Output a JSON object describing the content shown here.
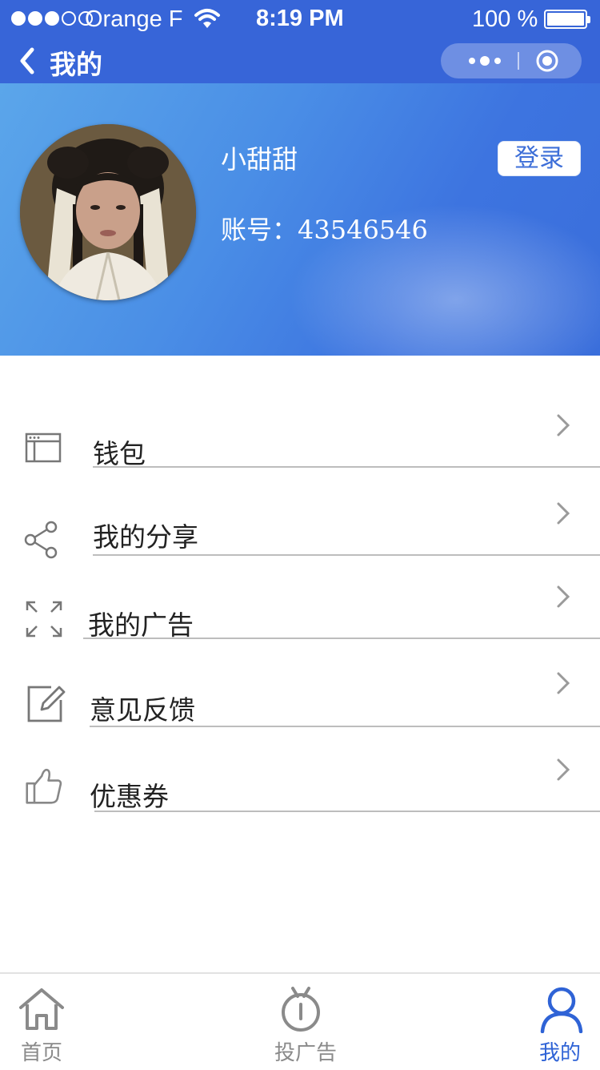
{
  "status_bar": {
    "carrier": "Orange F",
    "time": "8:19 PM",
    "battery": "100 %",
    "signal_bars_filled": 3,
    "signal_bars_total": 5
  },
  "nav": {
    "title": "我的"
  },
  "profile": {
    "username": "小甜甜",
    "account_label": "账号：",
    "account_number": "43546546",
    "login_label": "登录"
  },
  "menu": [
    {
      "label": "钱包",
      "icon": "wallet-icon"
    },
    {
      "label": "我的分享",
      "icon": "share-icon"
    },
    {
      "label": "我的广告",
      "icon": "fullscreen-icon"
    },
    {
      "label": "意见反馈",
      "icon": "edit-icon"
    },
    {
      "label": "优惠券",
      "icon": "thumbs-up-icon"
    }
  ],
  "tabs": [
    {
      "label": "首页",
      "icon": "home-icon",
      "active": false
    },
    {
      "label": "投广告",
      "icon": "alarm-icon",
      "active": false
    },
    {
      "label": "我的",
      "icon": "user-icon",
      "active": true
    }
  ],
  "colors": {
    "primary": "#3765d8",
    "active_tab": "#2f63d6",
    "inactive_tab": "#8a8a8a",
    "divider": "#bdbdbd"
  }
}
